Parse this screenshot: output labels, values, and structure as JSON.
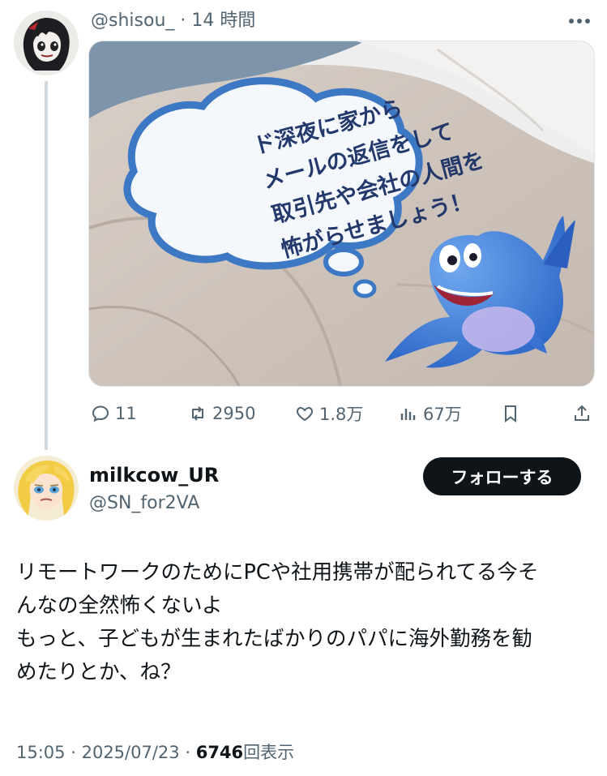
{
  "parent_tweet": {
    "handle": "@shisou_",
    "separator": "·",
    "time_ago": "14 時間",
    "image_bubble_lines": [
      "ド深夜に家から",
      "メールの返信をして",
      "取引先や会社の人間を",
      "怖がらせましょう！"
    ],
    "actions": {
      "replies": "11",
      "reposts": "2950",
      "likes": "1.8万",
      "views": "67万"
    },
    "icons": [
      "reply-icon",
      "repost-icon",
      "like-icon",
      "views-icon",
      "bookmark-icon",
      "share-icon"
    ]
  },
  "reply_tweet": {
    "display_name": "milkcow_UR",
    "handle": "@SN_for2VA",
    "follow_label": "フォローする",
    "body_lines": [
      "リモートワークのためにPCや社用携帯が配られてる今そ",
      "んなの全然怖くないよ",
      "もっと、子どもが生まれたばかりのパパに海外勤務を勧",
      "めたりとか、ね？"
    ],
    "time": "15:05",
    "date": "2025/07/23",
    "separator": "·",
    "view_count": "6746",
    "view_suffix": "回表示"
  },
  "colors": {
    "text_primary": "#0f1419",
    "text_secondary": "#536471",
    "thread_line": "#cfd9de",
    "button_bg": "#0f1419",
    "bubble_text": "#23396b"
  }
}
